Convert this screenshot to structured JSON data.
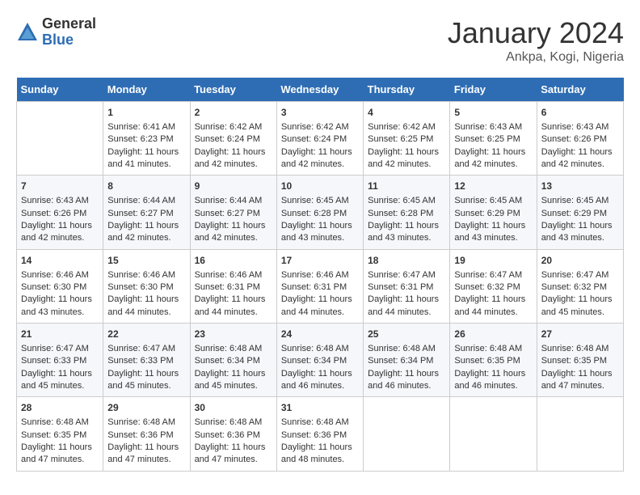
{
  "logo": {
    "general": "General",
    "blue": "Blue"
  },
  "title": "January 2024",
  "subtitle": "Ankpa, Kogi, Nigeria",
  "days_header": [
    "Sunday",
    "Monday",
    "Tuesday",
    "Wednesday",
    "Thursday",
    "Friday",
    "Saturday"
  ],
  "weeks": [
    [
      {
        "day": "",
        "sunrise": "",
        "sunset": "",
        "daylight": ""
      },
      {
        "day": "1",
        "sunrise": "Sunrise: 6:41 AM",
        "sunset": "Sunset: 6:23 PM",
        "daylight": "Daylight: 11 hours and 41 minutes."
      },
      {
        "day": "2",
        "sunrise": "Sunrise: 6:42 AM",
        "sunset": "Sunset: 6:24 PM",
        "daylight": "Daylight: 11 hours and 42 minutes."
      },
      {
        "day": "3",
        "sunrise": "Sunrise: 6:42 AM",
        "sunset": "Sunset: 6:24 PM",
        "daylight": "Daylight: 11 hours and 42 minutes."
      },
      {
        "day": "4",
        "sunrise": "Sunrise: 6:42 AM",
        "sunset": "Sunset: 6:25 PM",
        "daylight": "Daylight: 11 hours and 42 minutes."
      },
      {
        "day": "5",
        "sunrise": "Sunrise: 6:43 AM",
        "sunset": "Sunset: 6:25 PM",
        "daylight": "Daylight: 11 hours and 42 minutes."
      },
      {
        "day": "6",
        "sunrise": "Sunrise: 6:43 AM",
        "sunset": "Sunset: 6:26 PM",
        "daylight": "Daylight: 11 hours and 42 minutes."
      }
    ],
    [
      {
        "day": "7",
        "sunrise": "Sunrise: 6:43 AM",
        "sunset": "Sunset: 6:26 PM",
        "daylight": "Daylight: 11 hours and 42 minutes."
      },
      {
        "day": "8",
        "sunrise": "Sunrise: 6:44 AM",
        "sunset": "Sunset: 6:27 PM",
        "daylight": "Daylight: 11 hours and 42 minutes."
      },
      {
        "day": "9",
        "sunrise": "Sunrise: 6:44 AM",
        "sunset": "Sunset: 6:27 PM",
        "daylight": "Daylight: 11 hours and 42 minutes."
      },
      {
        "day": "10",
        "sunrise": "Sunrise: 6:45 AM",
        "sunset": "Sunset: 6:28 PM",
        "daylight": "Daylight: 11 hours and 43 minutes."
      },
      {
        "day": "11",
        "sunrise": "Sunrise: 6:45 AM",
        "sunset": "Sunset: 6:28 PM",
        "daylight": "Daylight: 11 hours and 43 minutes."
      },
      {
        "day": "12",
        "sunrise": "Sunrise: 6:45 AM",
        "sunset": "Sunset: 6:29 PM",
        "daylight": "Daylight: 11 hours and 43 minutes."
      },
      {
        "day": "13",
        "sunrise": "Sunrise: 6:45 AM",
        "sunset": "Sunset: 6:29 PM",
        "daylight": "Daylight: 11 hours and 43 minutes."
      }
    ],
    [
      {
        "day": "14",
        "sunrise": "Sunrise: 6:46 AM",
        "sunset": "Sunset: 6:30 PM",
        "daylight": "Daylight: 11 hours and 43 minutes."
      },
      {
        "day": "15",
        "sunrise": "Sunrise: 6:46 AM",
        "sunset": "Sunset: 6:30 PM",
        "daylight": "Daylight: 11 hours and 44 minutes."
      },
      {
        "day": "16",
        "sunrise": "Sunrise: 6:46 AM",
        "sunset": "Sunset: 6:31 PM",
        "daylight": "Daylight: 11 hours and 44 minutes."
      },
      {
        "day": "17",
        "sunrise": "Sunrise: 6:46 AM",
        "sunset": "Sunset: 6:31 PM",
        "daylight": "Daylight: 11 hours and 44 minutes."
      },
      {
        "day": "18",
        "sunrise": "Sunrise: 6:47 AM",
        "sunset": "Sunset: 6:31 PM",
        "daylight": "Daylight: 11 hours and 44 minutes."
      },
      {
        "day": "19",
        "sunrise": "Sunrise: 6:47 AM",
        "sunset": "Sunset: 6:32 PM",
        "daylight": "Daylight: 11 hours and 44 minutes."
      },
      {
        "day": "20",
        "sunrise": "Sunrise: 6:47 AM",
        "sunset": "Sunset: 6:32 PM",
        "daylight": "Daylight: 11 hours and 45 minutes."
      }
    ],
    [
      {
        "day": "21",
        "sunrise": "Sunrise: 6:47 AM",
        "sunset": "Sunset: 6:33 PM",
        "daylight": "Daylight: 11 hours and 45 minutes."
      },
      {
        "day": "22",
        "sunrise": "Sunrise: 6:47 AM",
        "sunset": "Sunset: 6:33 PM",
        "daylight": "Daylight: 11 hours and 45 minutes."
      },
      {
        "day": "23",
        "sunrise": "Sunrise: 6:48 AM",
        "sunset": "Sunset: 6:34 PM",
        "daylight": "Daylight: 11 hours and 45 minutes."
      },
      {
        "day": "24",
        "sunrise": "Sunrise: 6:48 AM",
        "sunset": "Sunset: 6:34 PM",
        "daylight": "Daylight: 11 hours and 46 minutes."
      },
      {
        "day": "25",
        "sunrise": "Sunrise: 6:48 AM",
        "sunset": "Sunset: 6:34 PM",
        "daylight": "Daylight: 11 hours and 46 minutes."
      },
      {
        "day": "26",
        "sunrise": "Sunrise: 6:48 AM",
        "sunset": "Sunset: 6:35 PM",
        "daylight": "Daylight: 11 hours and 46 minutes."
      },
      {
        "day": "27",
        "sunrise": "Sunrise: 6:48 AM",
        "sunset": "Sunset: 6:35 PM",
        "daylight": "Daylight: 11 hours and 47 minutes."
      }
    ],
    [
      {
        "day": "28",
        "sunrise": "Sunrise: 6:48 AM",
        "sunset": "Sunset: 6:35 PM",
        "daylight": "Daylight: 11 hours and 47 minutes."
      },
      {
        "day": "29",
        "sunrise": "Sunrise: 6:48 AM",
        "sunset": "Sunset: 6:36 PM",
        "daylight": "Daylight: 11 hours and 47 minutes."
      },
      {
        "day": "30",
        "sunrise": "Sunrise: 6:48 AM",
        "sunset": "Sunset: 6:36 PM",
        "daylight": "Daylight: 11 hours and 47 minutes."
      },
      {
        "day": "31",
        "sunrise": "Sunrise: 6:48 AM",
        "sunset": "Sunset: 6:36 PM",
        "daylight": "Daylight: 11 hours and 48 minutes."
      },
      {
        "day": "",
        "sunrise": "",
        "sunset": "",
        "daylight": ""
      },
      {
        "day": "",
        "sunrise": "",
        "sunset": "",
        "daylight": ""
      },
      {
        "day": "",
        "sunrise": "",
        "sunset": "",
        "daylight": ""
      }
    ]
  ]
}
